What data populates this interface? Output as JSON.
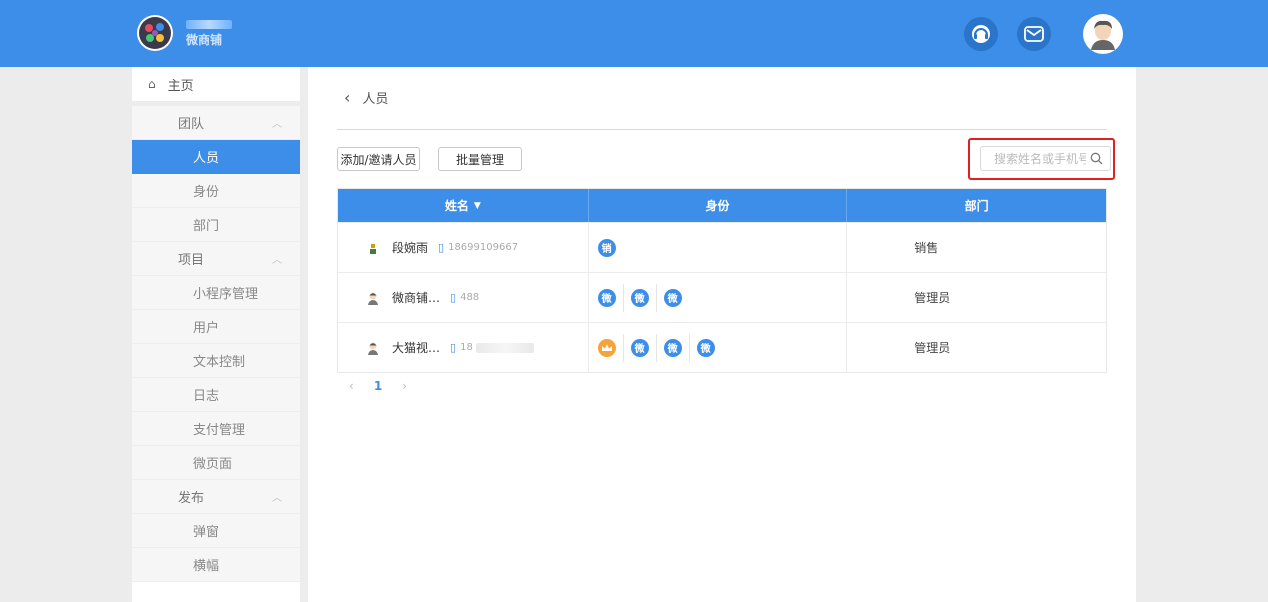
{
  "header": {
    "brand_name": "微商铺",
    "support_icon": "headset-icon",
    "mail_icon": "mail-icon",
    "avatar_icon": "user-avatar-icon"
  },
  "sidebar": {
    "home": "主页",
    "groups": [
      {
        "label": "团队",
        "items": [
          "人员",
          "身份",
          "部门"
        ]
      },
      {
        "label": "项目",
        "items": [
          "小程序管理",
          "用户",
          "文本控制",
          "日志",
          "支付管理",
          "微页面"
        ]
      },
      {
        "label": "发布",
        "items": [
          "弹窗",
          "横幅"
        ]
      }
    ],
    "active_item": "人员"
  },
  "main": {
    "breadcrumb": "人员",
    "buttons": {
      "add": "添加/邀请人员",
      "batch": "批量管理"
    },
    "search_placeholder": "搜索姓名或手机号",
    "table": {
      "headers": [
        "姓名",
        "身份",
        "部门"
      ],
      "rows": [
        {
          "name": "段婉雨",
          "phone": "18699109667",
          "roles": [
            "销"
          ],
          "dept": "销售"
        },
        {
          "name": "微商铺…",
          "phone": "488",
          "roles": [
            "微",
            "微",
            "微"
          ],
          "dept": "管理员"
        },
        {
          "name": "大猫视…",
          "phone": "18",
          "roles": [
            "crown",
            "微",
            "微",
            "微"
          ],
          "dept": "管理员"
        }
      ]
    },
    "pager": {
      "prev": "‹",
      "current": "1",
      "next": "›"
    }
  },
  "colors": {
    "accent": "#3d8ee8",
    "highlight": "#e02020",
    "crown": "#f5a33a"
  }
}
